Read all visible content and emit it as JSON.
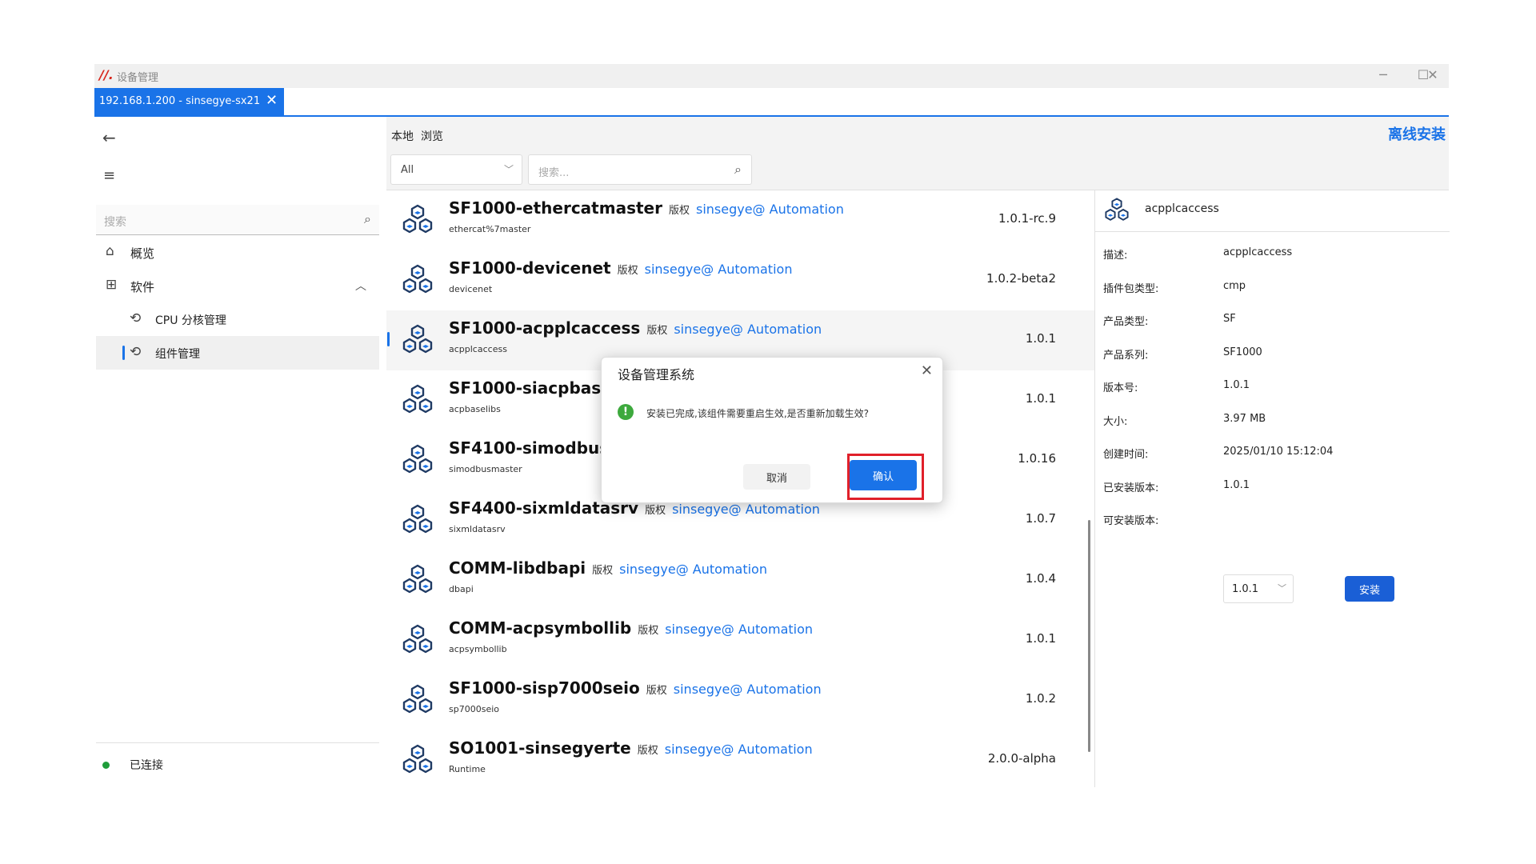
{
  "window": {
    "title": "设备管理",
    "logo_icon": "brand-logo-icon",
    "controls": [
      "minimize-icon",
      "maximize-icon",
      "close-icon"
    ]
  },
  "tab": {
    "label": "192.168.1.200 - sinsegye-sx21",
    "close_icon": "close-icon"
  },
  "sidebar": {
    "search_placeholder": "搜索",
    "items": [
      {
        "label": "概览",
        "icon": "home-icon"
      },
      {
        "label": "软件",
        "icon": "grid-icon",
        "expanded": true
      },
      {
        "label": "CPU 分核管理",
        "icon": "cpu-icon"
      },
      {
        "label": "组件管理",
        "icon": "component-icon",
        "active": true
      }
    ],
    "status_label": "已连接",
    "status_color": "#1f9d3a"
  },
  "main": {
    "tabs": [
      "本地",
      "浏览"
    ],
    "offline_install_label": "离线安装",
    "filter_value": "All",
    "search_placeholder": "搜索..."
  },
  "packages": [
    {
      "name": "SF1000-ethercatmaster",
      "license": "版权",
      "vendor": "sinsegye@ Automation",
      "sub": "ethercat%7master",
      "version": "1.0.1-rc.9"
    },
    {
      "name": "SF1000-devicenet",
      "license": "版权",
      "vendor": "sinsegye@ Automation",
      "sub": "devicenet",
      "version": "1.0.2-beta2"
    },
    {
      "name": "SF1000-acpplcaccess",
      "license": "版权",
      "vendor": "sinsegye@ Automation",
      "sub": "acpplcaccess",
      "version": "1.0.1",
      "selected": true
    },
    {
      "name": "SF1000-siacpbasel",
      "license": "",
      "vendor": "",
      "sub": "acpbaselibs",
      "version": "1.0.1"
    },
    {
      "name": "SF4100-simodbus",
      "license": "",
      "vendor": "",
      "sub": "simodbusmaster",
      "version": "1.0.16"
    },
    {
      "name": "SF4400-sixmldatasrv",
      "license": "版权",
      "vendor": "sinsegye@ Automation",
      "sub": "sixmldatasrv",
      "version": "1.0.7"
    },
    {
      "name": "COMM-libdbapi",
      "license": "版权",
      "vendor": "sinsegye@ Automation",
      "sub": "dbapi",
      "version": "1.0.4"
    },
    {
      "name": "COMM-acpsymbollib",
      "license": "版权",
      "vendor": "sinsegye@ Automation",
      "sub": "acpsymbollib",
      "version": "1.0.1"
    },
    {
      "name": "SF1000-sisp7000seio",
      "license": "版权",
      "vendor": "sinsegye@ Automation",
      "sub": "sp7000seio",
      "version": "1.0.2"
    },
    {
      "name": "SO1001-sinsegyerte",
      "license": "版权",
      "vendor": "sinsegye@ Automation",
      "sub": "Runtime",
      "version": "2.0.0-alpha"
    }
  ],
  "detail": {
    "title": "acpplcaccess",
    "fields": [
      {
        "k": "描述:",
        "v": "acpplcaccess"
      },
      {
        "k": "插件包类型:",
        "v": "cmp"
      },
      {
        "k": "产品类型:",
        "v": "SF"
      },
      {
        "k": "产品系列:",
        "v": "SF1000"
      },
      {
        "k": "版本号:",
        "v": "1.0.1"
      },
      {
        "k": "大小:",
        "v": "3.97 MB"
      },
      {
        "k": "创建时间:",
        "v": "2025/01/10 15:12:04"
      },
      {
        "k": "已安装版本:",
        "v": "1.0.1"
      },
      {
        "k": "可安装版本:",
        "v": ""
      }
    ],
    "installable_version": "1.0.1",
    "install_label": "安装"
  },
  "dialog": {
    "title": "设备管理系统",
    "message": "安装已完成,该组件需要重启生效,是否重新加载生效?",
    "icon": "warning-icon",
    "cancel_label": "取消",
    "ok_label": "确认",
    "highlight_color": "#e0202a"
  },
  "accent_color": "#1a73e8"
}
